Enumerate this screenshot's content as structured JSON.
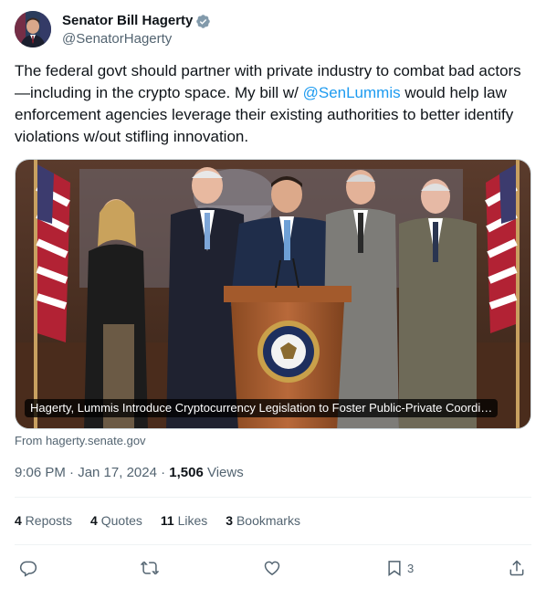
{
  "author": {
    "display_name": "Senator Bill Hagerty",
    "handle": "@SenatorHagerty",
    "verified_icon": "verified-badge-icon"
  },
  "tweet": {
    "text_before": "The federal govt should partner with private industry to combat bad actors—including in the crypto space. My bill w/ ",
    "mention": "@SenLummis",
    "text_after": " would help law enforcement agencies leverage their existing authorities to better identify violations w/out stifling innovation."
  },
  "card": {
    "caption": "Hagerty, Lummis Introduce Cryptocurrency Legislation to Foster Public-Private Coordi…",
    "source": "From hagerty.senate.gov"
  },
  "meta": {
    "time": "9:06 PM · Jan 17, 2024 · ",
    "views_count": "1,506",
    "views_label": " Views"
  },
  "stats": [
    {
      "count": "4",
      "label": " Reposts"
    },
    {
      "count": "4",
      "label": " Quotes"
    },
    {
      "count": "11",
      "label": " Likes"
    },
    {
      "count": "3",
      "label": " Bookmarks"
    }
  ],
  "actions": {
    "bookmark_count": "3"
  },
  "colors": {
    "link": "#1d9bf0",
    "secondary_text": "#536471",
    "verified": "#829aab"
  }
}
